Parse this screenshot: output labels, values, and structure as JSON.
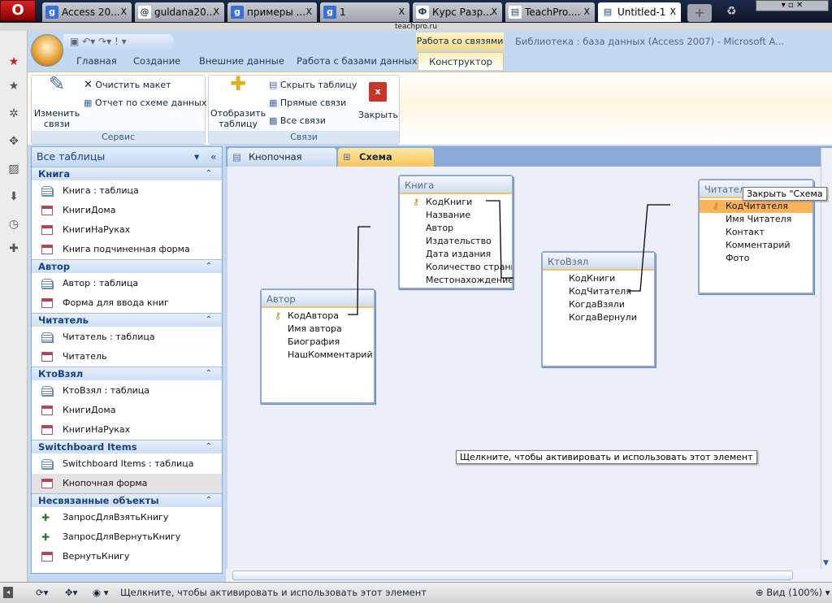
{
  "browser": {
    "menu_label": "O",
    "tabs": [
      {
        "label": "Access 20...",
        "icon": "google-icon",
        "fav": "g"
      },
      {
        "label": "guldana20...",
        "icon": "mail-icon",
        "fav": "@"
      },
      {
        "label": "примеры ...",
        "icon": "google-icon",
        "fav": "g"
      },
      {
        "label": "1",
        "icon": "google-icon",
        "fav": "g"
      },
      {
        "label": "Курс Разр...",
        "icon": "phi-icon",
        "fav": "Ф"
      },
      {
        "label": "TeachPro....",
        "icon": "page-icon",
        "fav": "▤"
      },
      {
        "label": "Untitled-1",
        "icon": "page-icon",
        "fav": "▤"
      }
    ],
    "address": "teachpro.ru",
    "close_glyph": "X"
  },
  "access": {
    "contextual_tab": "Работа со связями",
    "window_title": "Библиотека : база данных (Access 2007) - Microsoft A...",
    "ribbon_tabs": [
      "Главная",
      "Создание",
      "Внешние данные",
      "Работа с базами данных",
      "Конструктор"
    ],
    "groups": {
      "service": {
        "label": "Сервис",
        "edit": "Изменить связи",
        "clear": "Очистить макет",
        "report": "Отчет по схеме данных"
      },
      "links": {
        "label": "Связи",
        "show": "Отобразить таблицу",
        "hide": "Скрыть таблицу",
        "direct": "Прямые связи",
        "all": "Все связи",
        "close": "Закрыть"
      }
    },
    "nav": {
      "title": "Все таблицы",
      "groups": [
        {
          "label": "Книга",
          "items": [
            {
              "label": "Книга : таблица",
              "type": "table"
            },
            {
              "label": "КнигиДома",
              "type": "form"
            },
            {
              "label": "КнигиНаРуках",
              "type": "form"
            },
            {
              "label": "Книга подчиненная форма",
              "type": "form"
            }
          ]
        },
        {
          "label": "Автор",
          "items": [
            {
              "label": "Автор : таблица",
              "type": "table"
            },
            {
              "label": "Форма для ввода книг",
              "type": "form"
            }
          ]
        },
        {
          "label": "Читатель",
          "items": [
            {
              "label": "Читатель : таблица",
              "type": "table"
            },
            {
              "label": "Читатель",
              "type": "form"
            }
          ]
        },
        {
          "label": "КтоВзял",
          "items": [
            {
              "label": "КтоВзял : таблица",
              "type": "table"
            },
            {
              "label": "КнигиДома",
              "type": "form"
            },
            {
              "label": "КнигиНаРуках",
              "type": "form"
            }
          ]
        },
        {
          "label": "Switchboard Items",
          "items": [
            {
              "label": "Switchboard Items : таблица",
              "type": "table"
            },
            {
              "label": "Кнопочная форма",
              "type": "form",
              "selected": true
            }
          ]
        },
        {
          "label": "Несвязанные объекты",
          "items": [
            {
              "label": "ЗапросДляВзятьКнигу",
              "type": "query"
            },
            {
              "label": "ЗапросДляВернутьКнигу",
              "type": "query"
            },
            {
              "label": "ВернутьКнигу",
              "type": "form"
            }
          ]
        }
      ]
    },
    "doc_tabs": [
      "Кнопочная форма",
      "Схема данных"
    ],
    "tables": {
      "kniga": {
        "title": "Книга",
        "fields": [
          "КодКниги",
          "Название",
          "Автор",
          "Издательство",
          "Дата издания",
          "Количество страниц",
          "Местонахождение"
        ]
      },
      "avtor": {
        "title": "Автор",
        "fields": [
          "КодАвтора",
          "Имя автора",
          "Биография",
          "НашКомментарий"
        ]
      },
      "ktovzyal": {
        "title": "КтоВзял",
        "fields": [
          "КодКниги",
          "КодЧитателя",
          "КогдаВзяли",
          "КогдаВернули"
        ]
      },
      "chitatel": {
        "title": "Читатель",
        "fields": [
          "КодЧитателя",
          "Имя Читателя",
          "Контакт",
          "Комментарий",
          "Фото"
        ]
      }
    },
    "tooltip_close": "Закрыть \"Схема",
    "tooltip_activate": "Щелкните, чтобы активировать и использовать этот элемент",
    "accent": "#fbb35a"
  },
  "status": {
    "message": "Щелкните, чтобы активировать и использовать этот элемент",
    "zoom": "Вид (100%)"
  }
}
